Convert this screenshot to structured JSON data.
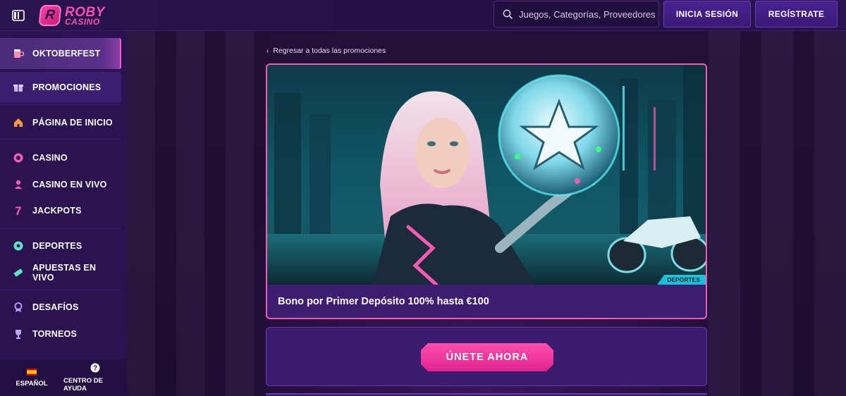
{
  "brand": {
    "line1": "ROBY",
    "line2": "CASINO",
    "badge": "R"
  },
  "header": {
    "search_placeholder": "Juegos, Categorías, Proveedores",
    "login_label": "INICIA SESIÓN",
    "register_label": "REGÍSTRATE"
  },
  "sidebar": {
    "items": [
      {
        "label": "OKTOBERFEST",
        "icon": "beer-mug-icon"
      },
      {
        "label": "PROMOCIONES",
        "icon": "gift-icon"
      },
      {
        "label": "PÁGINA DE INICIO",
        "icon": "home-icon"
      },
      {
        "label": "CASINO",
        "icon": "casino-chip-icon"
      },
      {
        "label": "CASINO EN VIVO",
        "icon": "live-dealer-icon"
      },
      {
        "label": "JACKPOTS",
        "icon": "seven-icon"
      },
      {
        "label": "DEPORTES",
        "icon": "soccer-ball-icon"
      },
      {
        "label": "APUESTAS EN VIVO",
        "icon": "ticket-icon"
      },
      {
        "label": "DESAFÍOS",
        "icon": "medal-icon"
      },
      {
        "label": "TORNEOS",
        "icon": "trophy-icon"
      }
    ],
    "footer": {
      "language_label": "ESPAÑOL",
      "help_label": "CENTRO DE AYUDA"
    }
  },
  "main": {
    "back_link": "Regresar a todas las promociones",
    "promo": {
      "tag": "DEPORTES",
      "title": "Bono por Primer Depósito 100% hasta €100"
    },
    "cta_label": "ÚNETE AHORA"
  },
  "colors": {
    "accent_pink": "#ff5ab6",
    "bg_purple": "#2a1350",
    "tag_cyan": "#19c2d8"
  }
}
